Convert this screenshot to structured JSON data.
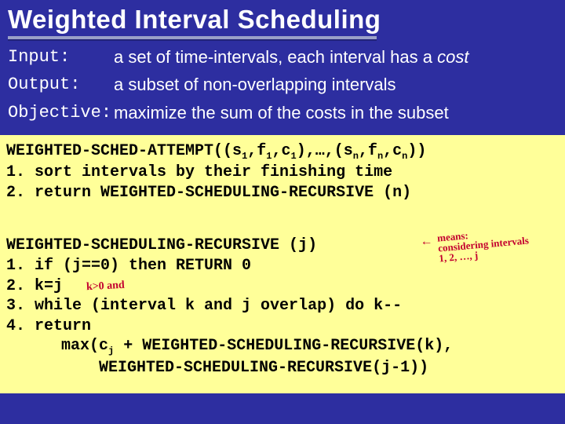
{
  "title": "Weighted Interval Scheduling",
  "defs": {
    "input": {
      "label": "Input:",
      "text_a": "a set of time-intervals, each interval has a ",
      "text_b": "cost"
    },
    "output": {
      "label": "Output:",
      "text": "a subset of non-overlapping intervals"
    },
    "objective": {
      "label": "Objective:",
      "text": "maximize the sum of the costs in the subset"
    }
  },
  "code1": {
    "l1a": "WEIGHTED-SCHED-ATTEMPT((s",
    "l1b": ",f",
    "l1c": ",c",
    "l1d": "),…,(s",
    "l1e": ",f",
    "l1f": ",c",
    "l1g": "))",
    "sub1": "1",
    "subn": "n",
    "l2": "1. sort intervals by their finishing time",
    "l3": "2. return WEIGHTED-SCHEDULING-RECURSIVE (n)"
  },
  "code2": {
    "l1": "WEIGHTED-SCHEDULING-RECURSIVE (j)",
    "l2": "1. if (j==0) then RETURN 0",
    "l3": "2. k=j",
    "l4": "3. while (interval k and j overlap) do k--",
    "l5": "4. return",
    "l6a": "max(c",
    "l6b": " + WEIGHTED-SCHEDULING-RECURSIVE(k),",
    "subj": "j",
    "l7": "    WEIGHTED-SCHEDULING-RECURSIVE(j-1))"
  },
  "annotations": {
    "means_arrow": "←",
    "means_l1": "means:",
    "means_l2": "considering intervals",
    "means_l3": "1, 2, …, j",
    "kcond": "k>0 and"
  }
}
